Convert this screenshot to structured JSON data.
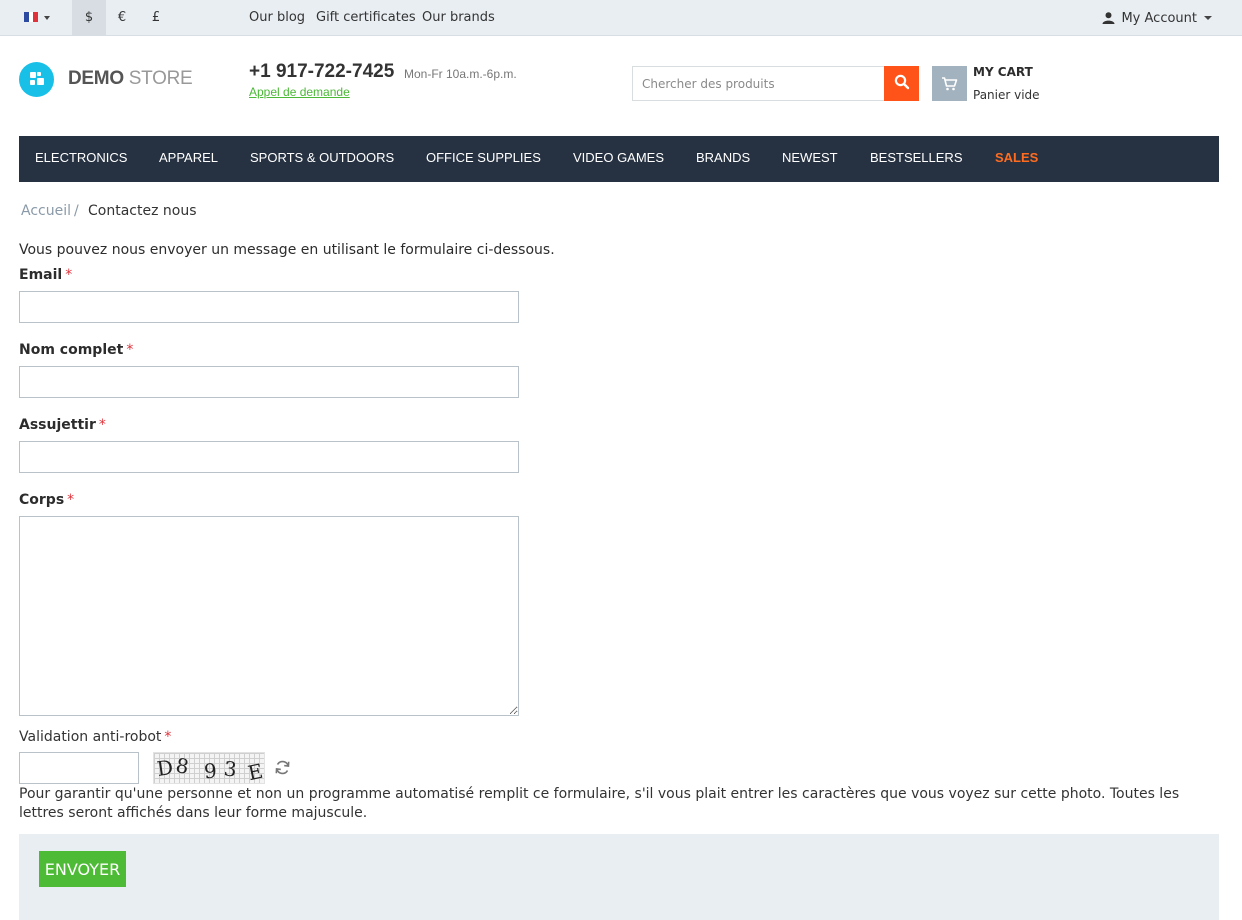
{
  "topbar": {
    "language": "fr",
    "currencies": [
      "$",
      "€",
      "£"
    ],
    "active_currency": "$",
    "links": [
      "Our blog",
      "Gift certificates",
      "Our brands"
    ],
    "account_label": "My Account"
  },
  "header": {
    "logo_bold": "DEMO",
    "logo_light": "STORE",
    "phone": "+1 917-722-7425",
    "hours": "Mon-Fr 10a.m.-6p.m.",
    "callback_link": "Appel de demande",
    "search_placeholder": "Chercher des produits",
    "cart_title": "MY CART",
    "cart_status": "Panier vide"
  },
  "nav": {
    "items": [
      "ELECTRONICS",
      "APPAREL",
      "SPORTS & OUTDOORS",
      "OFFICE SUPPLIES",
      "VIDEO GAMES",
      "BRANDS",
      "NEWEST",
      "BESTSELLERS",
      "SALES"
    ]
  },
  "breadcrumb": {
    "home": "Accueil",
    "separator": "/",
    "current": "Contactez nous"
  },
  "form": {
    "intro": "Vous pouvez nous envoyer un message en utilisant le formulaire ci-dessous.",
    "required_mark": "*",
    "email_label": "Email",
    "email_value": "",
    "name_label": "Nom complet",
    "name_value": "",
    "subject_label": "Assujettir",
    "subject_value": "",
    "body_label": "Corps",
    "body_value": "",
    "captcha_label": "Validation anti-robot",
    "captcha_chars": [
      "D",
      "8",
      "9",
      "3",
      "E"
    ],
    "captcha_help": "Pour garantir qu'une personne et non un programme automatisé remplit ce formulaire, s'il vous plait entrer les caractères que vous voyez sur cette photo. Toutes les lettres seront affichés dans leur forme majuscule.",
    "submit_label": "ENVOYER"
  },
  "colors": {
    "nav_bg": "#263241",
    "sales": "#ff6c1f",
    "search_button": "#ff5319",
    "submit": "#4dbb35",
    "link_green": "#4bb836",
    "logo_blue": "#18c0e8"
  }
}
